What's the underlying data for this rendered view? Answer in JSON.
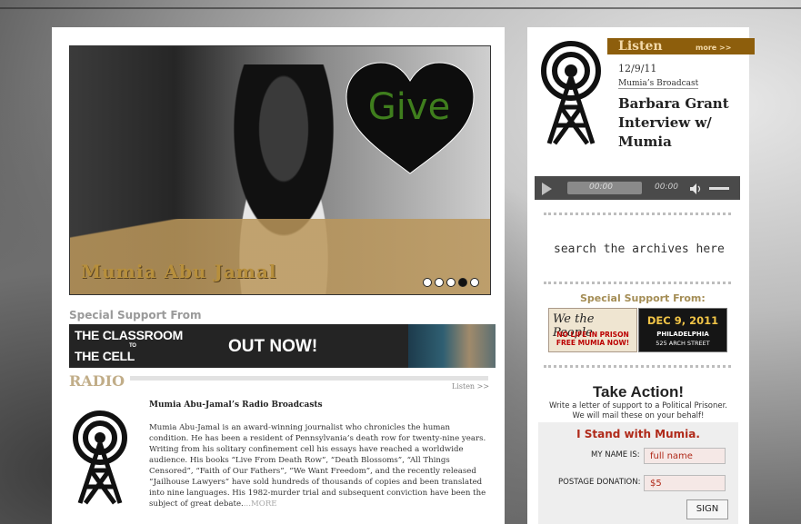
{
  "hero": {
    "name_caption": "Mumia Abu Jamal",
    "give_label": "Give",
    "slides": [
      false,
      false,
      false,
      true,
      false
    ]
  },
  "special_support_left": "Special Support From",
  "banner": {
    "left_line1": "THE CLASSROOM",
    "left_small": "TO",
    "left_line2": "THE CELL",
    "center": "OUT NOW!"
  },
  "radio": {
    "title": "RADIO",
    "listen_link": "Listen >>",
    "heading": "Mumia Abu-Jamal’s Radio Broadcasts",
    "body": "Mumia Abu-Jamal is an award-winning journalist who chronicles the human condition. He has been a resident of Pennsylvania’s death row for twenty-nine years. Writing from his solitary confinement cell his essays have reached a worldwide audience. His books “Live From Death Row”, “Death Blossoms”, “All Things Censored”, “Faith of Our Fathers”, “We Want Freedom”, and the recently released “Jailhouse Lawyers” have sold hundreds of thousands of copies and been translated into nine languages. His 1982-murder trial and subsequent conviction have been the subject of great debate.",
    "more": "...MORE"
  },
  "listen": {
    "label": "Listen",
    "more": "more >>",
    "date": "12/9/11",
    "category": "Mumia’s Broadcast",
    "title": "Barbara Grant Interview w/ Mumia"
  },
  "player": {
    "current_time": "00:00",
    "duration": "00:00"
  },
  "search_archives": "search the archives here",
  "special_support_right": "Special Support From:",
  "ad_wethepeople": {
    "top": "We the People",
    "bottom": "NO LIFE IN PRISON FREE MUMIA NOW!"
  },
  "ad_event": {
    "date": "DEC 9, 2011",
    "city": "PHILADELPHIA",
    "address": "525 ARCH STREET"
  },
  "take_action": {
    "title": "Take Action!",
    "sub1": "Write a letter of support to a Political Prisoner.",
    "sub2": "We will mail these on your behalf!"
  },
  "form": {
    "title": "I Stand with Mumia.",
    "name_label": "MY NAME IS:",
    "name_placeholder": "full name",
    "postage_label": "POSTAGE DONATION:",
    "postage_value": "$5",
    "submit": "SIGN"
  },
  "colors": {
    "accent_brown": "#8d5e0c",
    "give_green": "#3f7e1d",
    "form_red": "#b02a1a"
  }
}
